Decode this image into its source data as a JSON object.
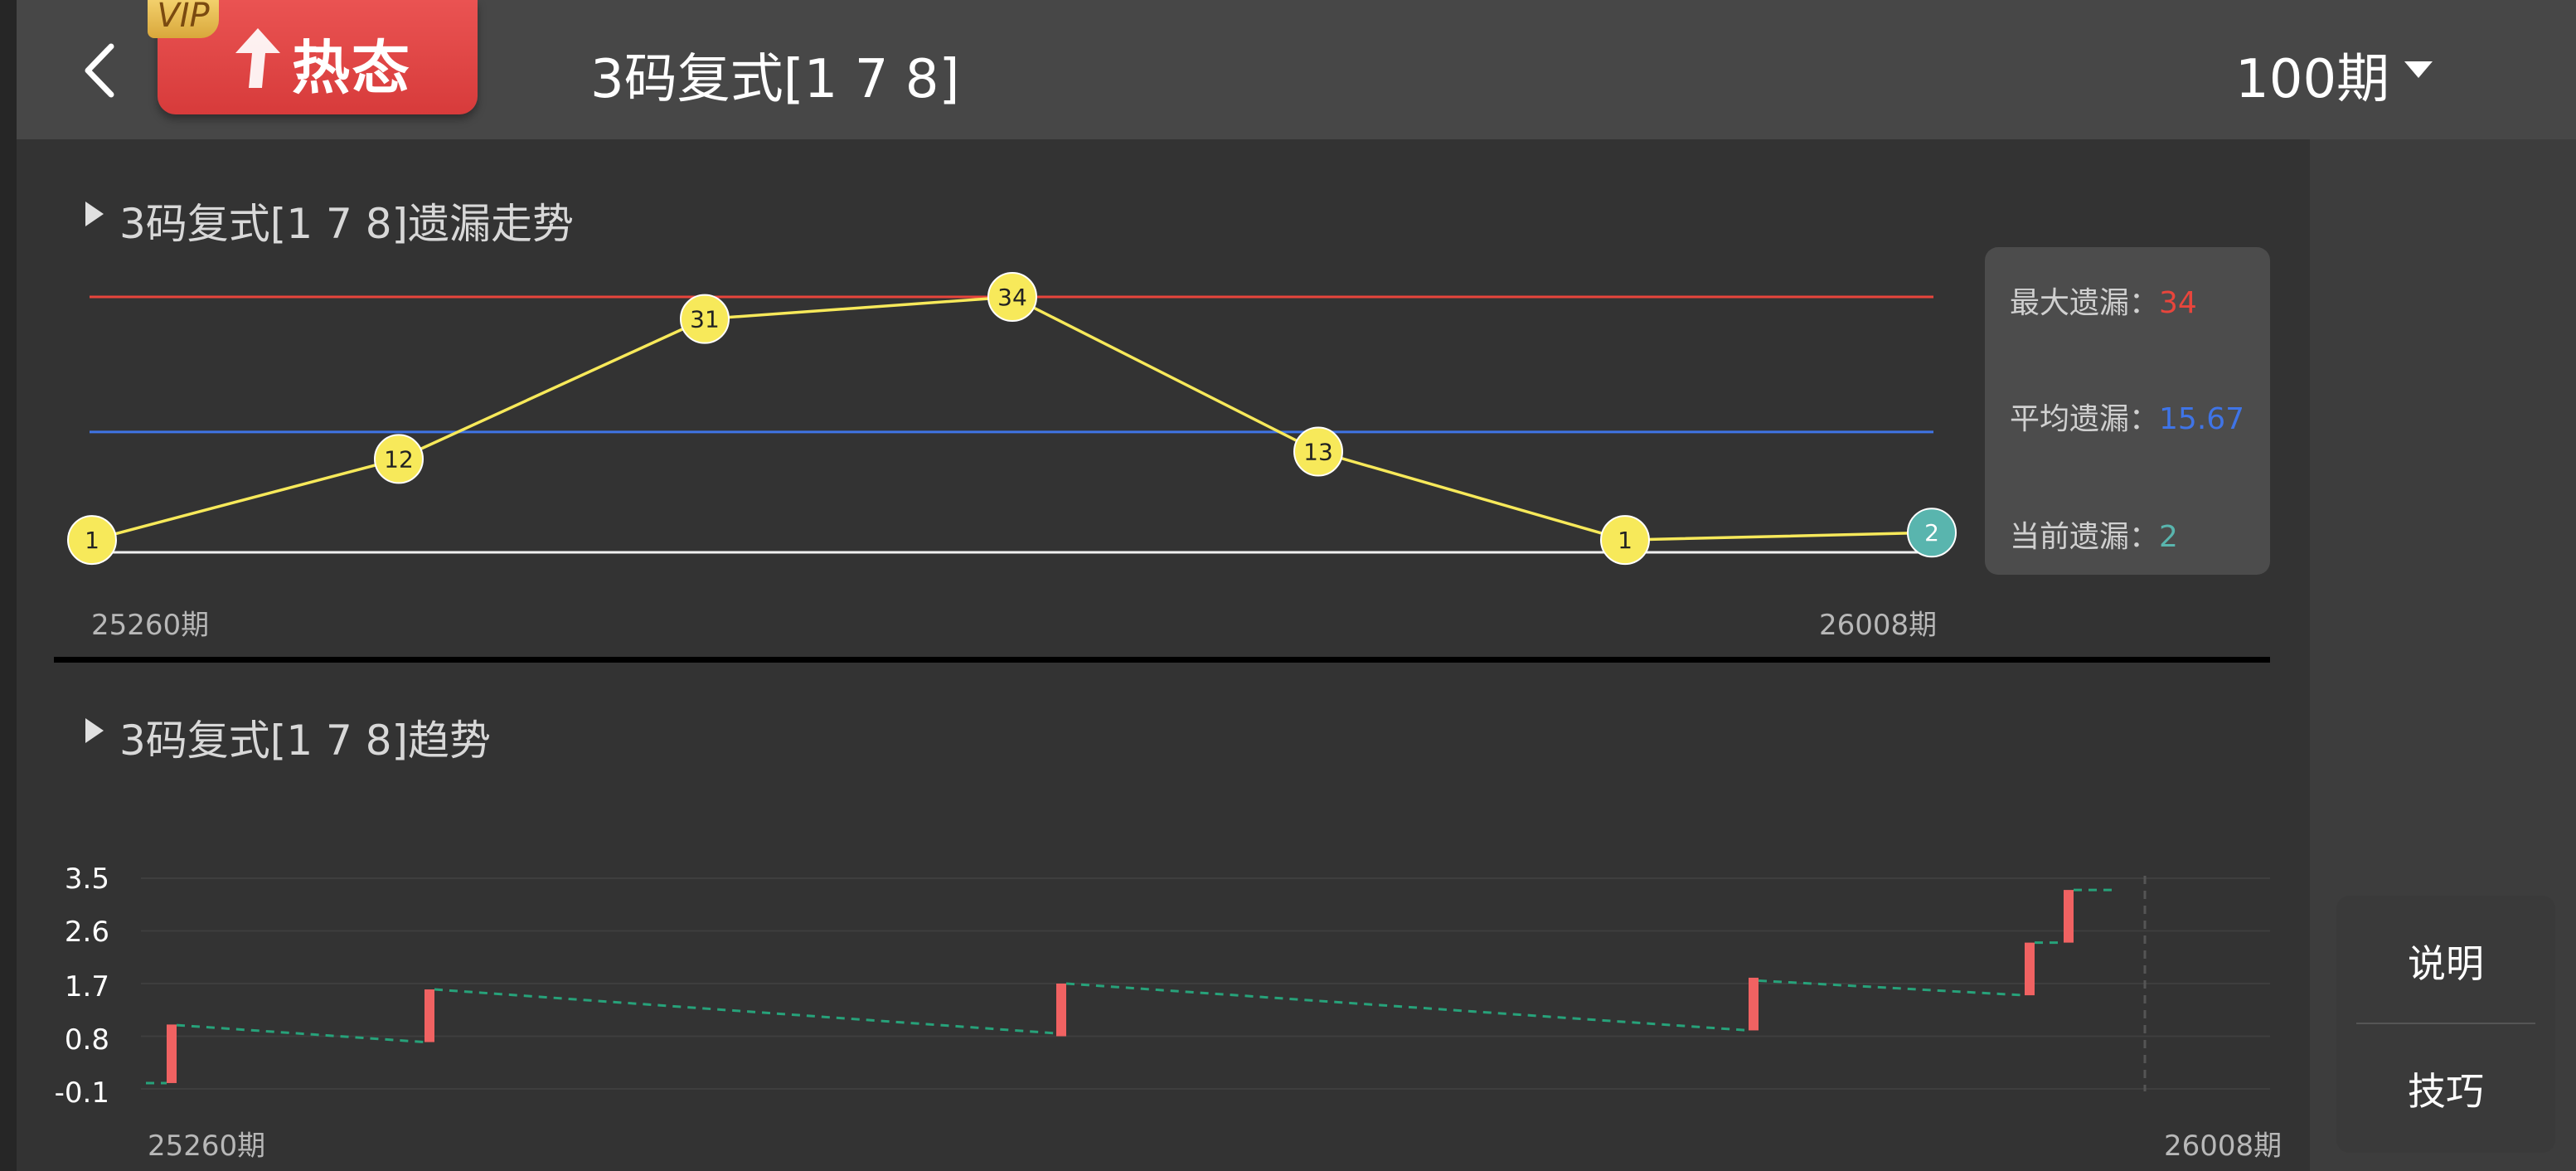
{
  "header": {
    "vip_tag": "VIP",
    "hot_label": "热态",
    "title": "3码复式[1 7 8]",
    "period": "100期"
  },
  "omission": {
    "title": "3码复式[1 7 8]遗漏走势",
    "stats": {
      "max_label": "最大遗漏：",
      "max_value": "34",
      "avg_label": "平均遗漏：",
      "avg_value": "15.67",
      "current_label": "当前遗漏：",
      "current_value": "2"
    },
    "x_start": "25260期",
    "x_end": "26008期"
  },
  "trend": {
    "title": "3码复式[1 7 8]趋势",
    "x_start": "25260期",
    "x_end": "26008期"
  },
  "help": {
    "explain": "说明",
    "tips": "技巧"
  },
  "colors": {
    "max_line": "#e8453c",
    "avg_line": "#3f74e6",
    "point": "#f7e95a",
    "current_point": "#59b5ae",
    "candle": "#f06262",
    "trend_line": "#27a27a"
  },
  "chart_data": [
    {
      "type": "line",
      "title": "3码复式[1 7 8]遗漏走势",
      "x": [
        "25260期",
        "",
        "",
        "",
        "",
        "",
        "26008期"
      ],
      "series": [
        {
          "values": [
            1,
            12,
            31,
            34,
            13,
            1,
            2
          ]
        }
      ],
      "reference_lines": {
        "max": 34,
        "average": 15.67,
        "current": 2
      },
      "labels": [
        "1",
        "12",
        "31",
        "34",
        "13",
        "1",
        "2"
      ]
    },
    {
      "type": "bar",
      "title": "3码复式[1 7 8]趋势",
      "x_start": "25260期",
      "x_end": "26008期",
      "yticks": [
        "3.5",
        "2.6",
        "1.7",
        "0.8",
        "-0.1"
      ],
      "ylim": [
        -0.1,
        3.5
      ],
      "candles": [
        {
          "low": 0.0,
          "high": 1.0
        },
        {
          "low": 0.7,
          "high": 1.6
        },
        {
          "low": 0.8,
          "high": 1.7
        },
        {
          "low": 0.9,
          "high": 1.8
        },
        {
          "low": 1.5,
          "high": 2.4
        },
        {
          "low": 2.4,
          "high": 3.3
        }
      ],
      "trend": [
        [
          0.05,
          0.99
        ],
        [
          0.7,
          1.6
        ],
        [
          0.85,
          1.7
        ],
        [
          0.9,
          1.75
        ],
        [
          1.5,
          2.4
        ],
        [
          2.4,
          3.3
        ]
      ]
    }
  ]
}
